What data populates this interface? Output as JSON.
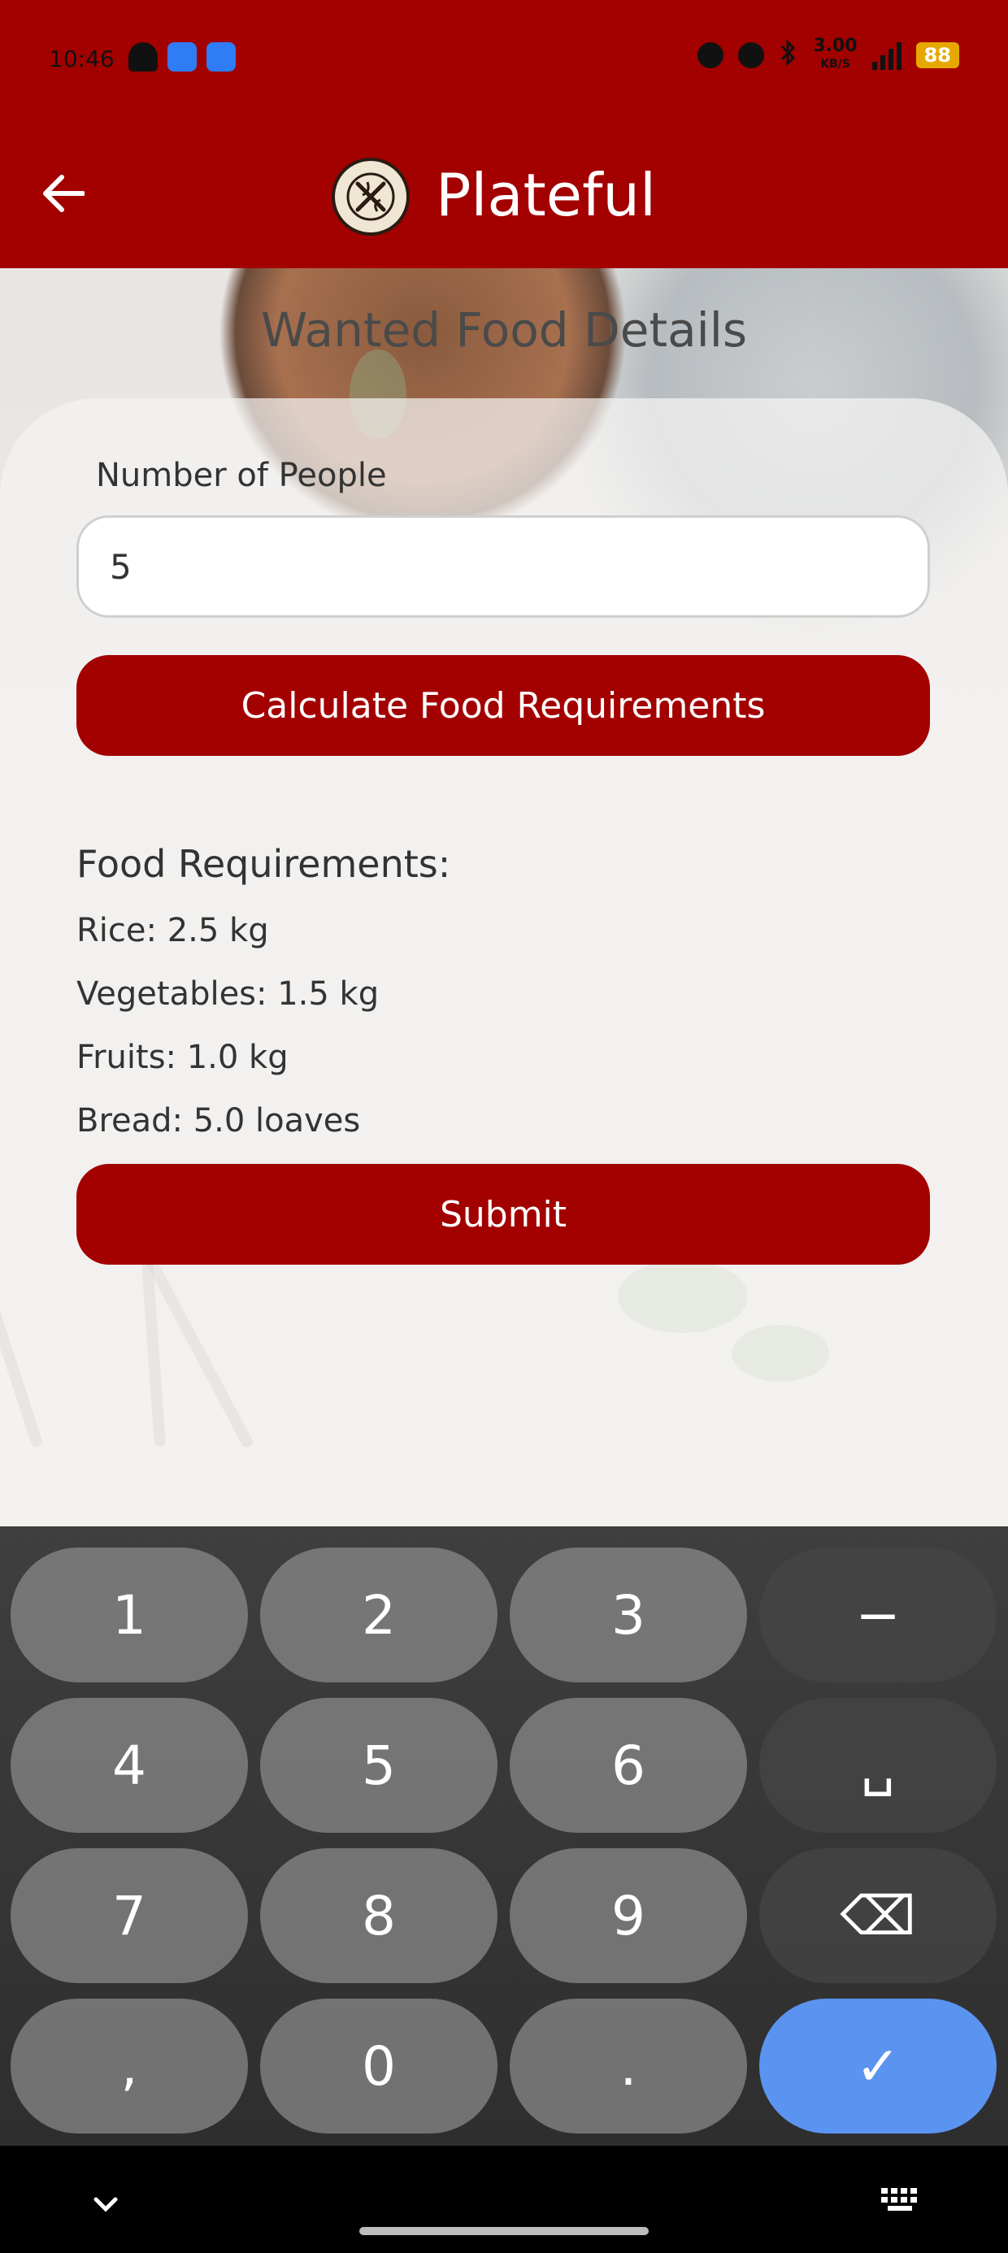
{
  "status_bar": {
    "time": "10:46",
    "net_speed": "3.00",
    "net_unit": "KB/S",
    "battery": "88"
  },
  "app_bar": {
    "title": "Plateful"
  },
  "page": {
    "heading": "Wanted Food Details"
  },
  "form": {
    "people_label": "Number of People",
    "people_value": "5",
    "calculate_label": "Calculate Food Requirements",
    "submit_label": "Submit"
  },
  "requirements": {
    "title": "Food Requirements:",
    "items": [
      "Rice: 2.5 kg",
      "Vegetables: 1.5 kg",
      "Fruits: 1.0 kg",
      "Bread: 5.0 loaves"
    ]
  },
  "keyboard": {
    "keys": [
      "1",
      "2",
      "3",
      "−",
      "4",
      "5",
      "6",
      "␣",
      "7",
      "8",
      "9",
      "⌫",
      ",",
      "0",
      ".",
      "✓"
    ]
  },
  "colors": {
    "brand": "#a30000",
    "enter_key": "#5b94f0"
  }
}
